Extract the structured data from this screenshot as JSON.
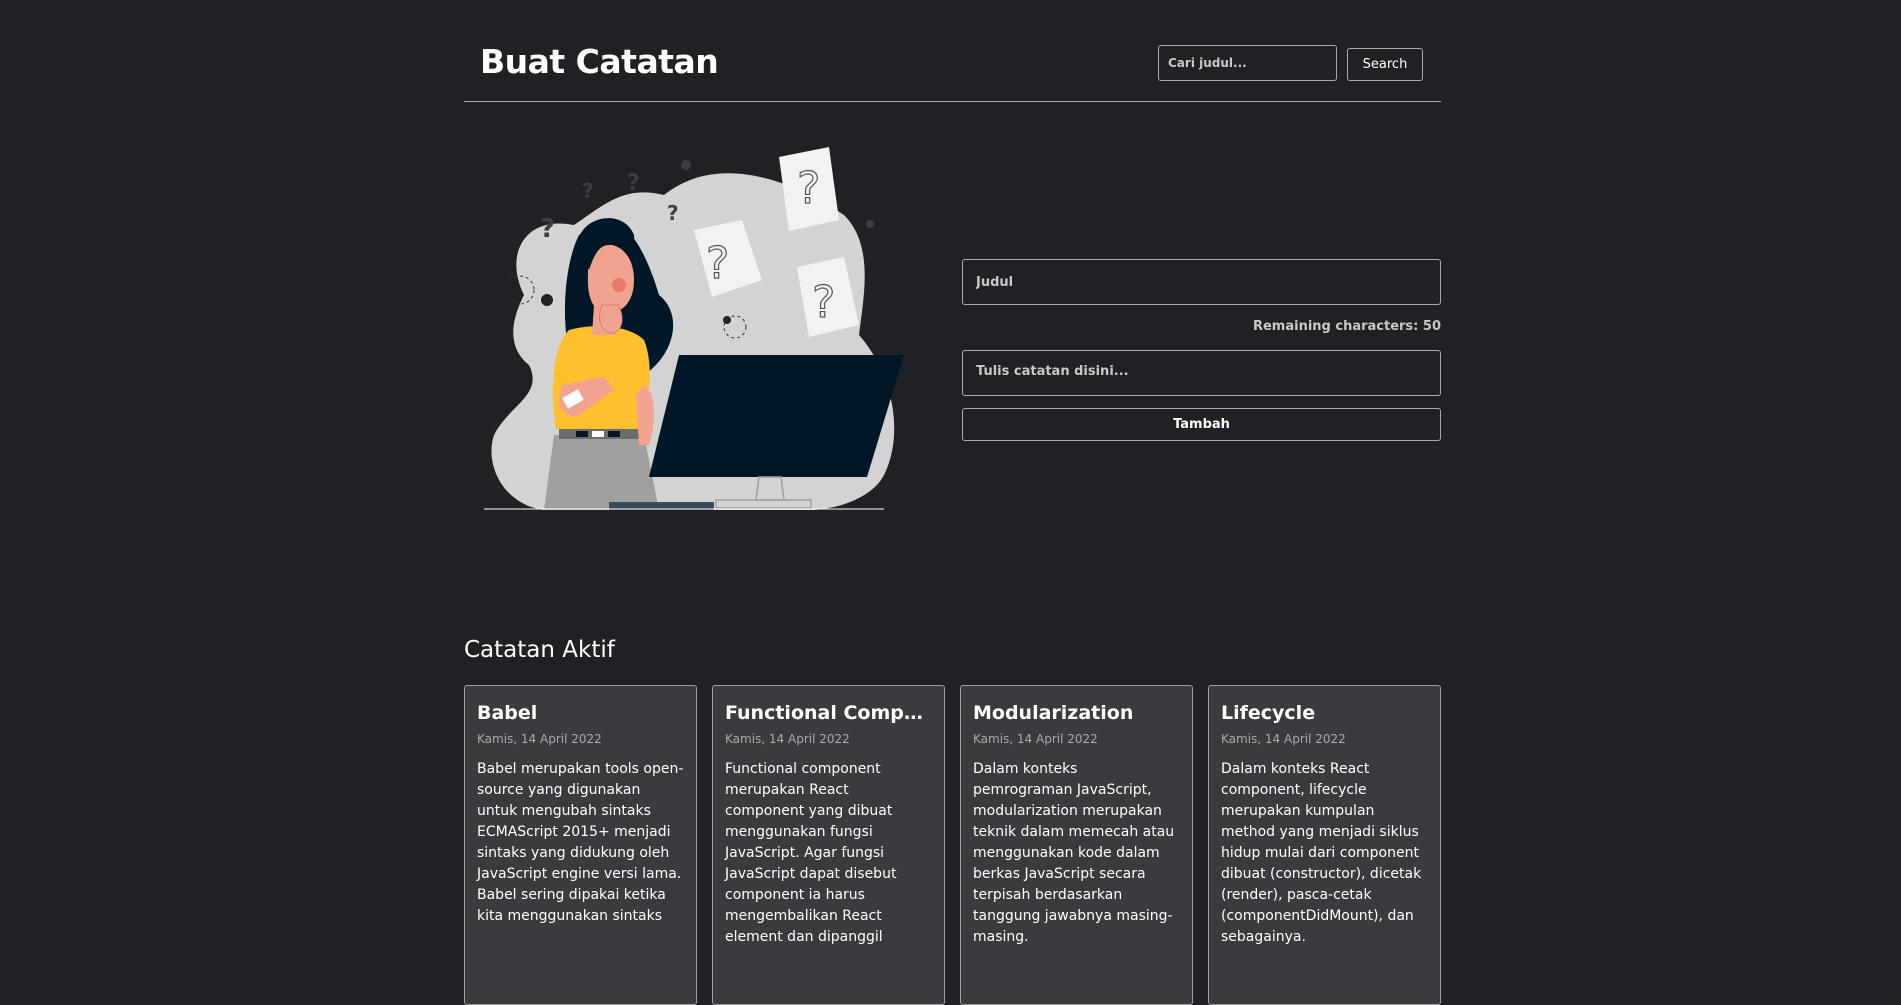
{
  "header": {
    "title": "Buat Catatan",
    "search_placeholder": "Cari judul...",
    "search_label": "Search"
  },
  "form": {
    "title_placeholder": "Judul",
    "remaining_label": "Remaining characters: ",
    "remaining_count": "50",
    "body_placeholder": "Tulis catatan disini...",
    "add_label": "Tambah"
  },
  "notes": {
    "section_title": "Catatan Aktif",
    "items": [
      {
        "title": "Babel",
        "date": "Kamis, 14 April 2022",
        "body": "Babel merupakan tools open-source yang digunakan untuk mengubah sintaks ECMAScript 2015+ menjadi sintaks yang didukung oleh JavaScript engine versi lama. Babel sering dipakai ketika kita menggunakan sintaks"
      },
      {
        "title": "Functional Component",
        "date": "Kamis, 14 April 2022",
        "body": "Functional component merupakan React component yang dibuat menggunakan fungsi JavaScript. Agar fungsi JavaScript dapat disebut component ia harus mengembalikan React element dan dipanggil"
      },
      {
        "title": "Modularization",
        "date": "Kamis, 14 April 2022",
        "body": "Dalam konteks pemrograman JavaScript, modularization merupakan teknik dalam memecah atau menggunakan kode dalam berkas JavaScript secara terpisah berdasarkan tanggung jawabnya masing-masing."
      },
      {
        "title": "Lifecycle",
        "date": "Kamis, 14 April 2022",
        "body": "Dalam konteks React component, lifecycle merupakan kumpulan method yang menjadi siklus hidup mulai dari component dibuat (constructor), dicetak (render), pasca-cetak (componentDidMount), dan sebagainya."
      }
    ]
  },
  "colors": {
    "background": "#202124",
    "card": "#3b3b3f",
    "border": "#aaaaaa",
    "shirt": "#fdc02f",
    "monitor": "#011627"
  }
}
